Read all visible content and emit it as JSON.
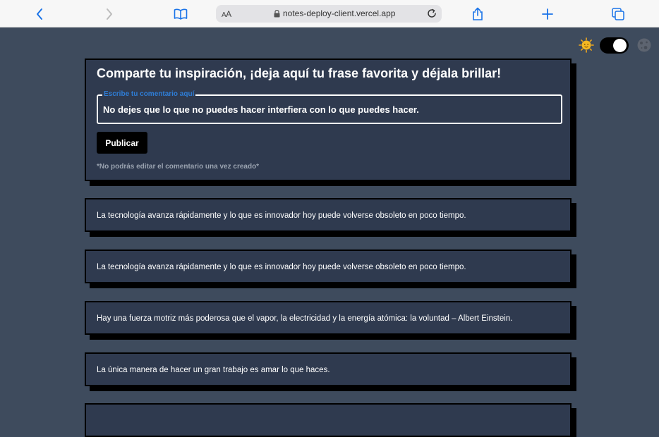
{
  "browser": {
    "text_size_label_small": "A",
    "text_size_label_large": "A",
    "url": "notes-deploy-client.vercel.app"
  },
  "theme": {
    "mode": "dark",
    "light_icon": "sun-icon",
    "dark_icon": "moon-icon"
  },
  "compose": {
    "title": "Comparte tu inspiración, ¡deja aquí tu frase favorita y déjala brillar!",
    "field_label": "Escribe tu comentario aquí",
    "field_value": "No dejes que lo que no puedes hacer interfiera con lo que puedes hacer.",
    "publish_label": "Publicar",
    "note": "*No podrás editar el comentario una vez creado*"
  },
  "comments": [
    "La tecnología avanza rápidamente y lo que es innovador hoy puede volverse obsoleto en poco tiempo.",
    "La tecnología avanza rápidamente y lo que es innovador hoy puede volverse obsoleto en poco tiempo.",
    "Hay una fuerza motriz más poderosa que el vapor, la electricidad y la energía atómica: la voluntad – Albert Einstein.",
    "La única manera de hacer un gran trabajo es amar lo que haces."
  ],
  "colors": {
    "page_bg": "#3e4b5d",
    "card_bg": "#2f3a4f",
    "accent": "#2f7dd6"
  }
}
